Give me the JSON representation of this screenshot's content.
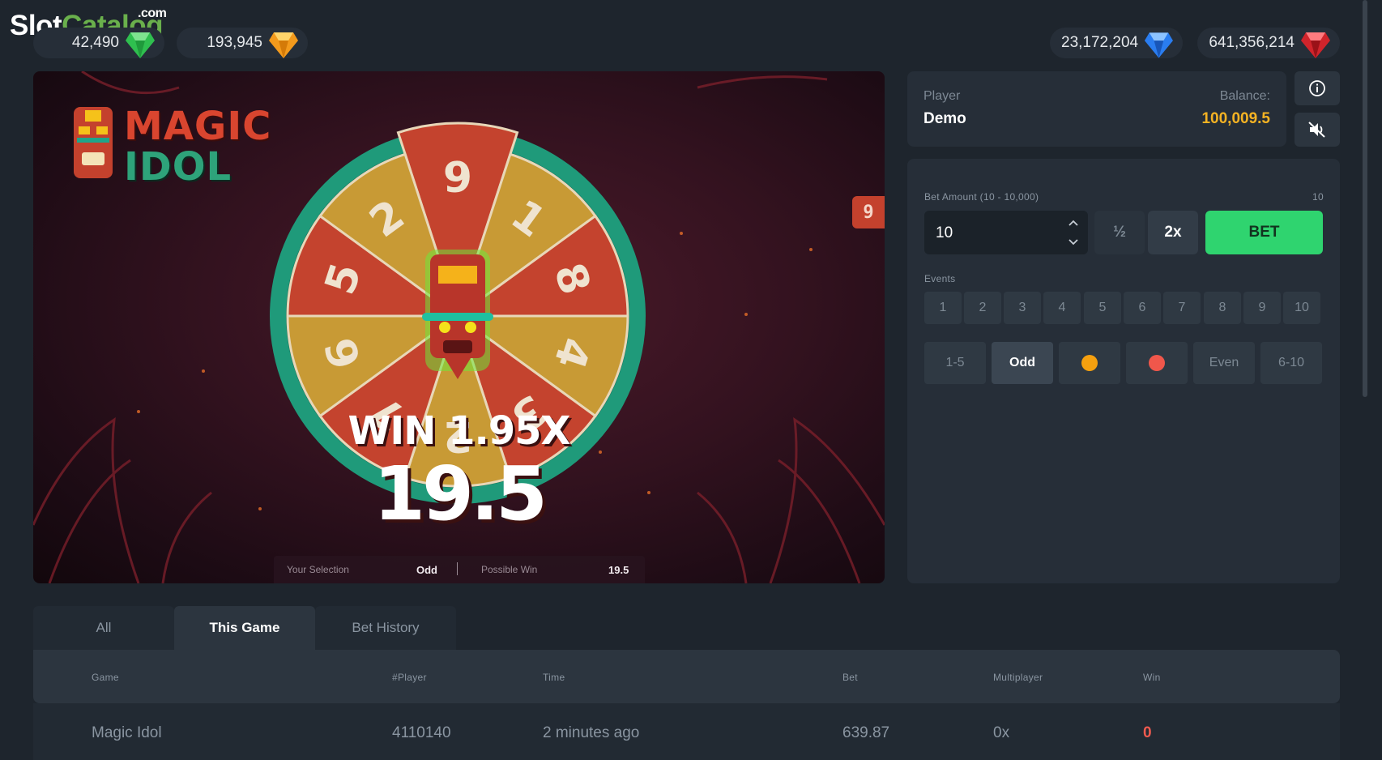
{
  "brand": {
    "name_a": "Slot",
    "name_b": "Catalog",
    "suffix": ".com"
  },
  "jackpots": [
    {
      "value": "42,490",
      "gem": "green-gem-icon",
      "color": "#2fbf4f"
    },
    {
      "value": "193,945",
      "gem": "orange-gem-icon",
      "color": "#f39a1c"
    },
    {
      "value": "23,172,204",
      "gem": "blue-gem-icon",
      "color": "#2a7df0"
    },
    {
      "value": "641,356,214",
      "gem": "red-gem-icon",
      "color": "#d0242b"
    }
  ],
  "game": {
    "logo_line1": "MAGIC",
    "logo_line2": "IDOL",
    "side_tag": "9",
    "wheel_numbers": [
      "9",
      "1",
      "8",
      "4",
      "3",
      "2",
      "7",
      "6",
      "5",
      "2"
    ],
    "win_label": "WIN 1.95X",
    "win_amount": "19.5",
    "selection_label": "Your Selection",
    "selection_value": "Odd",
    "possible_win_label": "Possible Win",
    "possible_win_value": "19.5"
  },
  "player": {
    "label": "Player",
    "name": "Demo",
    "balance_label": "Balance:",
    "balance": "100,009.5"
  },
  "bet": {
    "amount_label": "Bet Amount (10 - 10,000)",
    "amount_min": "10",
    "amount_value": "10",
    "half_label": "½",
    "double_label": "2x",
    "bet_label": "BET",
    "events_label": "Events",
    "event_numbers": [
      "1",
      "2",
      "3",
      "4",
      "5",
      "6",
      "7",
      "8",
      "9",
      "10"
    ],
    "event_groups": [
      "1-5",
      "Odd",
      "",
      "",
      "Even",
      "6-10"
    ],
    "selected_group": "Odd",
    "orange_color": "#f5a00f",
    "red_color": "#f0574b"
  },
  "tabs": [
    "All",
    "This Game",
    "Bet History"
  ],
  "active_tab": "This Game",
  "table": {
    "headers": [
      "Game",
      "#Player",
      "Time",
      "Bet",
      "Multiplayer",
      "Win"
    ],
    "rows": [
      [
        "Magic Idol",
        "4110140",
        "2 minutes ago",
        "639.87",
        "0x",
        "0"
      ]
    ]
  }
}
